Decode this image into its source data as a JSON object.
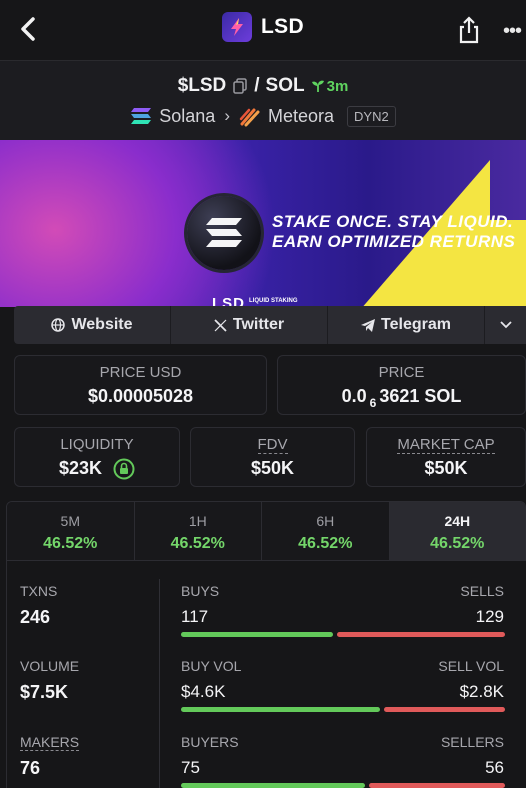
{
  "header": {
    "title": "LSD",
    "back_icon": "chevron-left-icon",
    "share_icon": "share-icon",
    "more_icon": "more-icon",
    "more_glyph": "•••"
  },
  "pair": {
    "base": "$LSD",
    "separator": "/",
    "quote": "SOL",
    "age": "3m",
    "chain": "Solana",
    "dex": "Meteora",
    "dex_tag": "DYN2",
    "age_color": "#5fd35f"
  },
  "banner": {
    "line1": "STAKE ONCE. STAY LIQUID.",
    "line2": "EARN OPTIMIZED RETURNS",
    "footer": "LSD",
    "footer_small": "LIQUID STAKING"
  },
  "links": {
    "website": "Website",
    "twitter": "Twitter",
    "telegram": "Telegram"
  },
  "prices": {
    "price_usd_label": "PRICE USD",
    "price_usd": "$0.00005028",
    "price_label": "PRICE",
    "price_prefix": "0.0",
    "price_zeros": "6",
    "price_suffix": "3621 SOL",
    "liquidity_label": "LIQUIDITY",
    "liquidity": "$23K",
    "fdv_label": "FDV",
    "fdv": "$50K",
    "mcap_label": "MARKET CAP",
    "mcap": "$50K"
  },
  "tabs": [
    {
      "label": "5M",
      "change": "46.52%"
    },
    {
      "label": "1H",
      "change": "46.52%"
    },
    {
      "label": "6H",
      "change": "46.52%"
    },
    {
      "label": "24H",
      "change": "46.52%"
    }
  ],
  "stats": {
    "txns_label": "TXNS",
    "txns": "246",
    "volume_label": "VOLUME",
    "volume": "$7.5K",
    "makers_label": "MAKERS",
    "makers": "76",
    "buys_label": "BUYS",
    "buys": "117",
    "sells_label": "SELLS",
    "sells": "129",
    "buy_vol_label": "BUY VOL",
    "buy_vol": "$4.6K",
    "sell_vol_label": "SELL VOL",
    "sell_vol": "$2.8K",
    "buyers_label": "BUYERS",
    "buyers": "75",
    "sellers_label": "SELLERS",
    "sellers": "56",
    "buy_ratio": 0.476,
    "buy_vol_ratio": 0.62,
    "buyer_ratio": 0.573,
    "buy_color": "#63c95a",
    "sell_color": "#e05a5a"
  }
}
